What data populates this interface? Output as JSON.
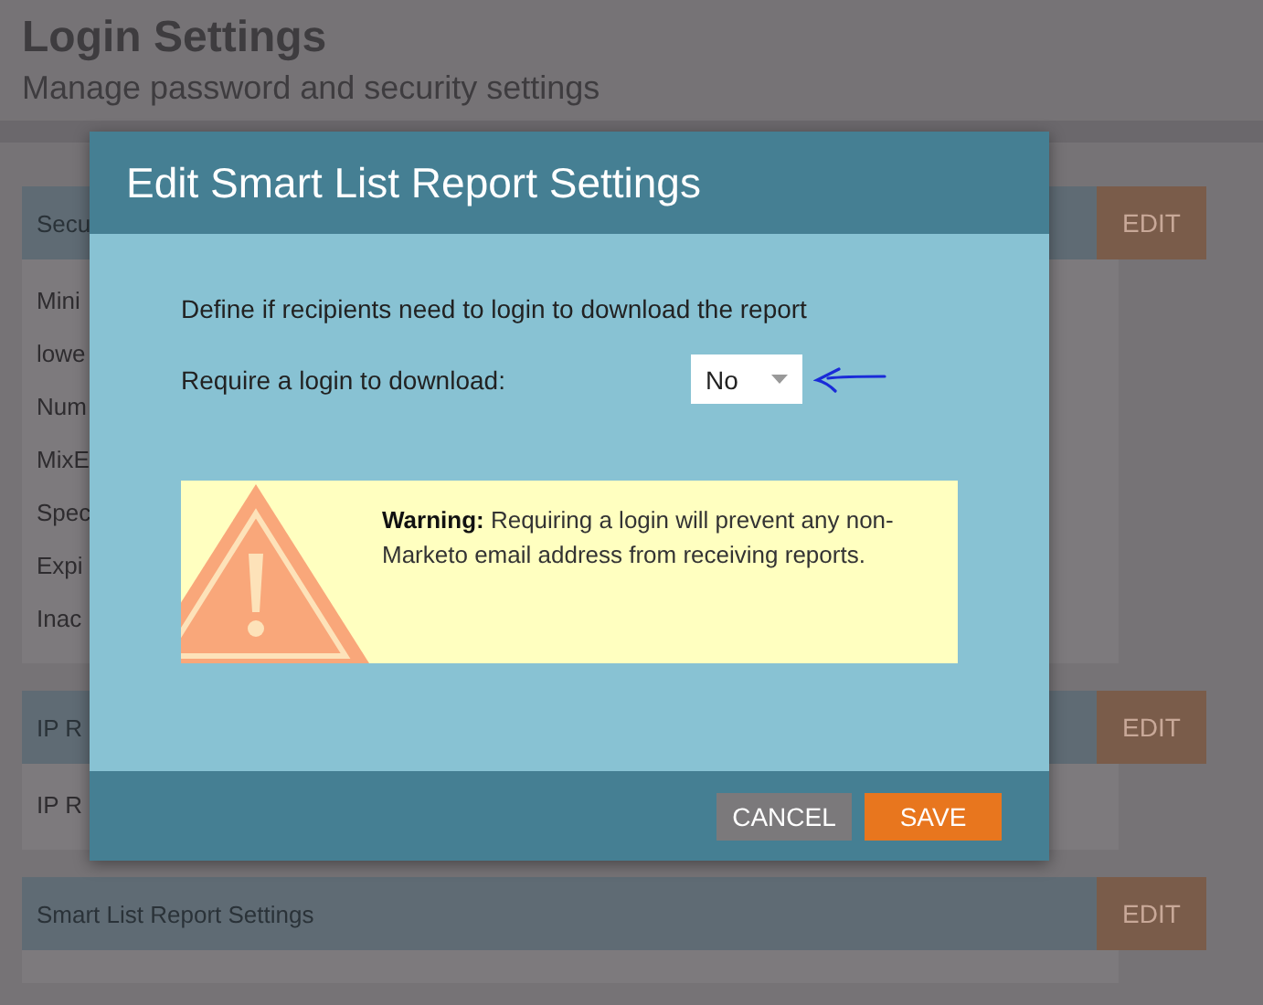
{
  "page": {
    "title": "Login Settings",
    "subtitle": "Manage password and security settings"
  },
  "sections": [
    {
      "header": "Secu",
      "edit": "EDIT",
      "rows": [
        "Mini",
        "lowe",
        "Num",
        "MixE",
        "Spec",
        "Expi",
        "Inac"
      ]
    },
    {
      "header": "IP R",
      "edit": "EDIT",
      "rows": [
        "IP R"
      ]
    },
    {
      "header": "Smart List Report Settings",
      "edit": "EDIT"
    }
  ],
  "dialog": {
    "title": "Edit Smart List Report Settings",
    "description": "Define if recipients need to login to download the report",
    "field": {
      "label": "Require a login to download:",
      "value": "No"
    },
    "warning": "**Warning:** Requiring a login will prevent any non-Marketo email address from receiving reports.",
    "buttons": [
      {
        "label": "CANCEL",
        "kind": "secondary"
      },
      {
        "label": "SAVE",
        "kind": "primary"
      }
    ]
  }
}
